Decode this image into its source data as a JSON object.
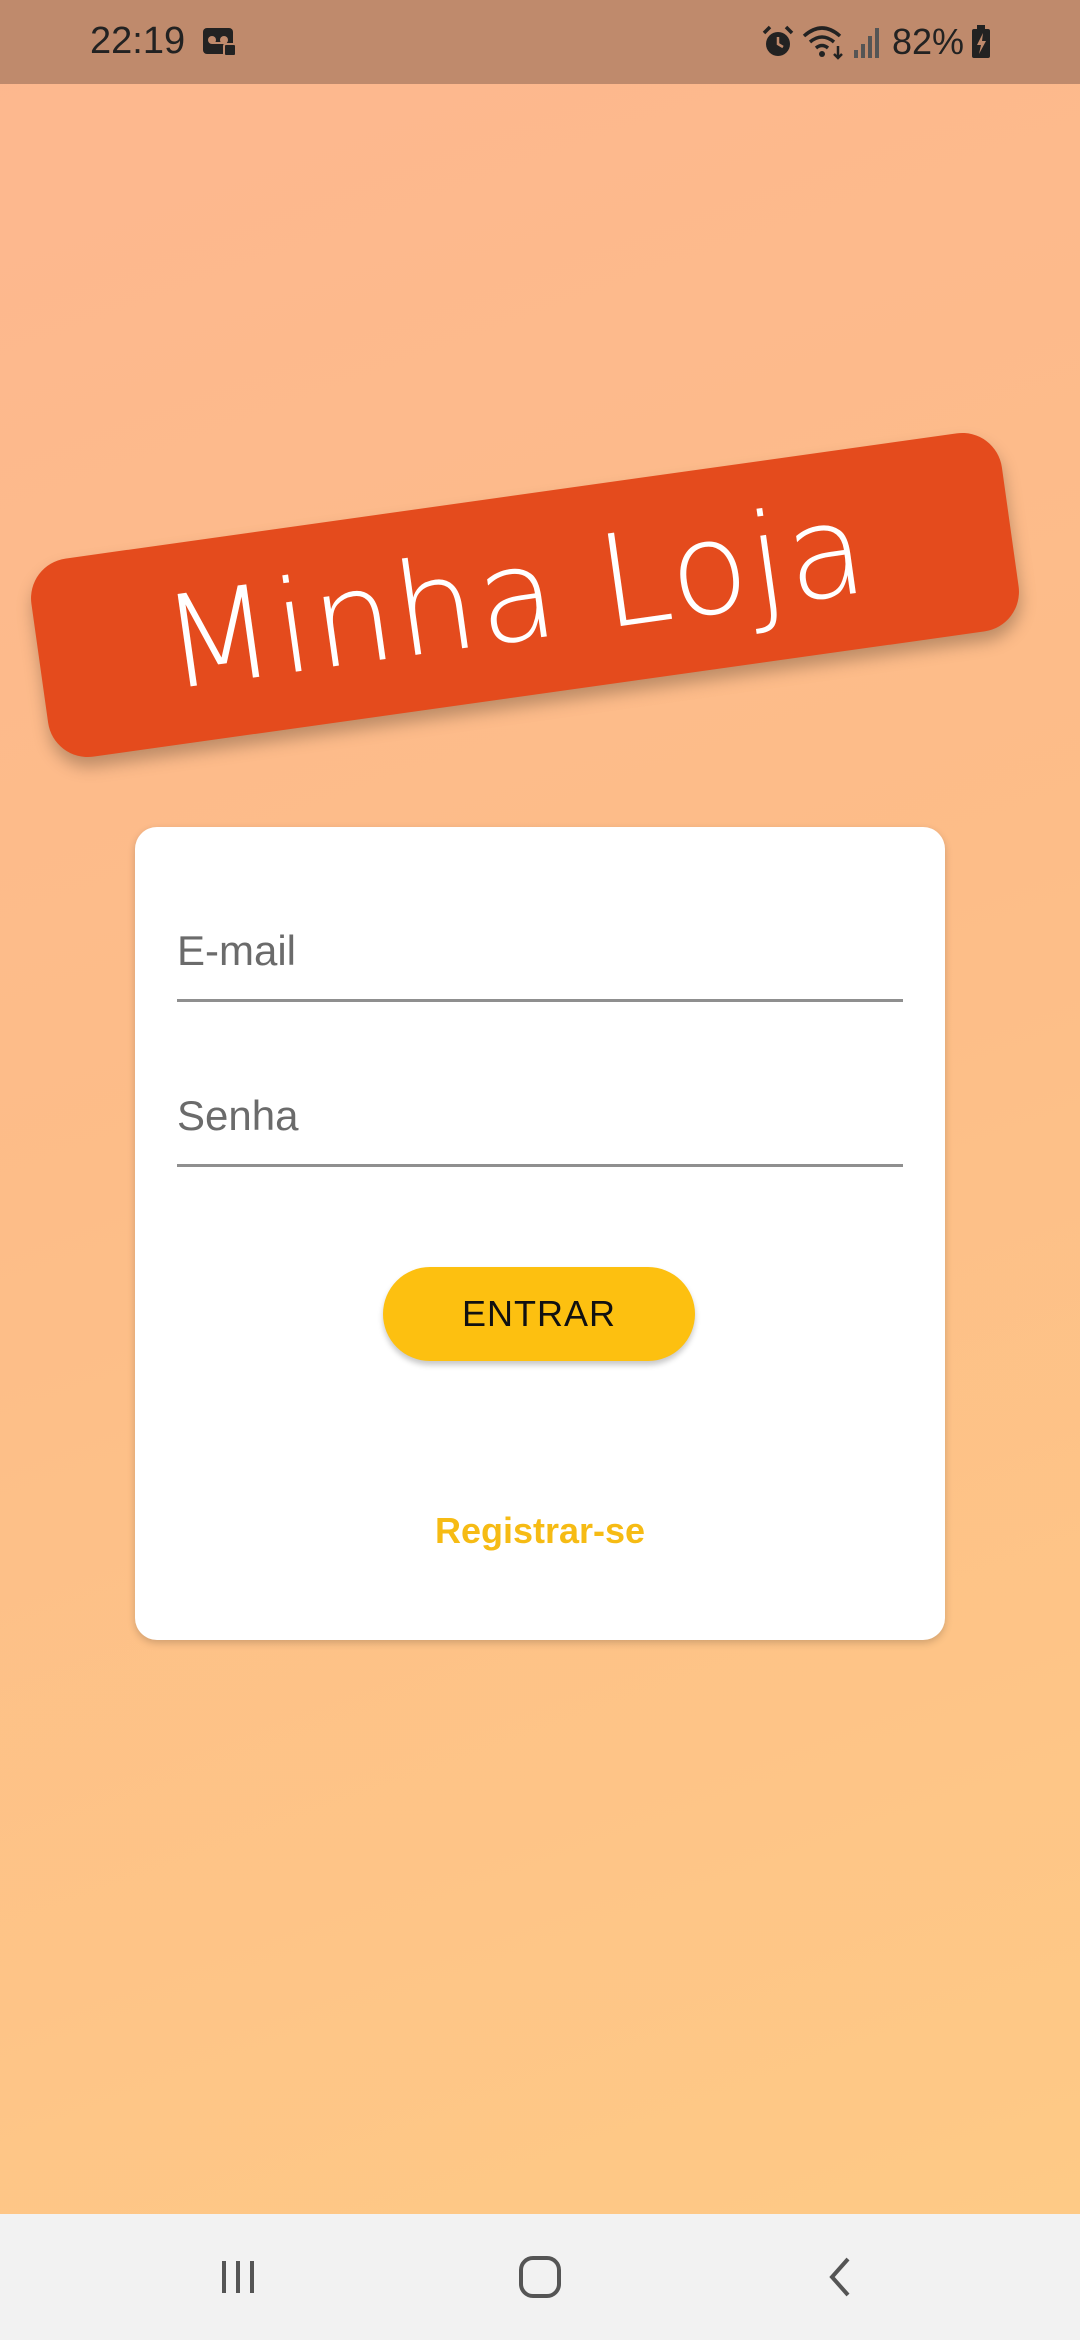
{
  "status_bar": {
    "time": "22:19",
    "battery": "82%",
    "icons": [
      "voicemail-icon",
      "alarm-icon",
      "wifi-icon",
      "signal-icon",
      "battery-charging-icon"
    ]
  },
  "logo": {
    "text": "Minha Loja",
    "color": "#e44b1d"
  },
  "form": {
    "email_placeholder": "E-mail",
    "password_placeholder": "Senha",
    "submit_label": "ENTRAR",
    "register_label": "Registrar-se"
  },
  "colors": {
    "accent": "#fdc010",
    "link": "#f6bb14",
    "background_top": "#fdb78f",
    "background_bottom": "#fecb86"
  },
  "nav_bar": {
    "icons": [
      "recents-icon",
      "home-icon",
      "back-icon"
    ]
  }
}
